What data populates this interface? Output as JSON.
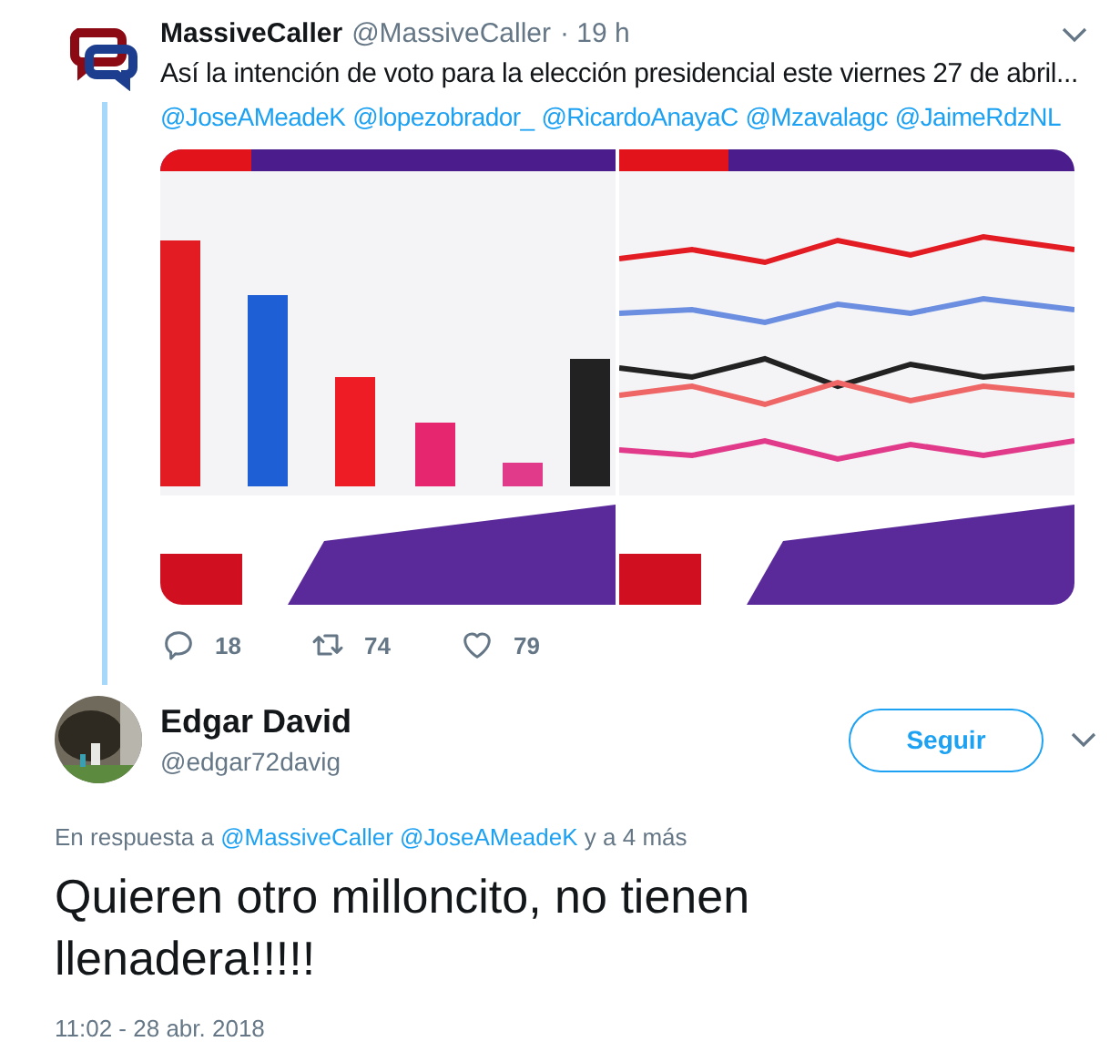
{
  "tweet": {
    "author": {
      "name": "MassiveCaller",
      "handle": "@MassiveCaller",
      "time": "· 19 h"
    },
    "text": "Así la intención de voto para la elección presidencial este viernes 27 de abril...",
    "mentions": [
      "@JoseAMeadeK",
      "@lopezobrador_",
      "@RicardoAnayaC",
      "@Mzavalagc",
      "@JaimeRdzNL"
    ],
    "actions": [
      {
        "kind": "reply",
        "count": "18"
      },
      {
        "kind": "retweet",
        "count": "74"
      },
      {
        "kind": "like",
        "count": "79"
      }
    ]
  },
  "reply": {
    "author": {
      "name": "Edgar David",
      "handle": "@edgar72davig"
    },
    "follow_button": "Seguir",
    "in_reply_to": {
      "prefix": "En respuesta a",
      "mentions": [
        "@MassiveCaller",
        "@JoseAMeadeK"
      ],
      "suffix": "y a 4 más"
    },
    "text": "Quieren otro milloncito, no tienen llenadera!!!!!",
    "timestamp": "11:02 - 28 abr. 2018"
  }
}
